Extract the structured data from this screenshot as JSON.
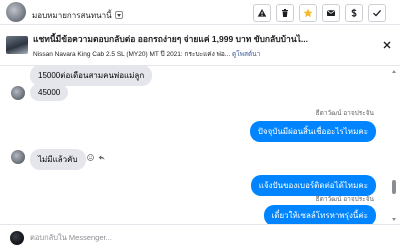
{
  "header": {
    "assign_label": "มอบหมายการสนทนานี้",
    "toolbar": [
      {
        "icon": "alert-icon",
        "color": "#1c1e21"
      },
      {
        "icon": "trash-icon",
        "color": "#1c1e21"
      },
      {
        "icon": "star-icon",
        "color": "#f7b928"
      },
      {
        "icon": "mail-icon",
        "color": "#1c1e21"
      },
      {
        "icon": "dollar-icon",
        "color": "#1c1e21"
      },
      {
        "icon": "check-icon",
        "color": "#1c1e21"
      }
    ]
  },
  "listing": {
    "title": "แชทนี้มีข้อความตอบกลับต่อ ออกรถง่ายๆ จ่ายแค่ 1,999 บาท ขับกลับบ้านไ...",
    "subtitle": "Nissan Navara King Cab 2.5 SL (MY20) MT ปี 2021: กระบะแค่ง พ่อ...",
    "see_details": "ดูโพสต์นา"
  },
  "messages": {
    "m1": "15000ต่อเดือนสามคนพ่อแม่ลูก",
    "m2": "45000",
    "sender_a": "ธีดาวัฒน์ อาจประจัน",
    "m3": "ปัจจุบันมีผ่อนสิ้นเชื่ออะไรไหมคะ",
    "m4": "ไม่มีแล้วคับ",
    "m5": "แจ้งปันของเบอร์ติดต่อได้ไหมคะ",
    "sender_b": "ธีดาวัฒน์ อาจประจัน",
    "m6": "เดี๋ยวให้เซลล์โทรหาพรุ่งนี้ค่ะ"
  },
  "composer": {
    "placeholder": "ตอบกลับใน Messenger..."
  },
  "colors": {
    "outgoing_bubble": "#0084ff",
    "incoming_bubble": "#e4e6eb",
    "star": "#f7b928"
  }
}
